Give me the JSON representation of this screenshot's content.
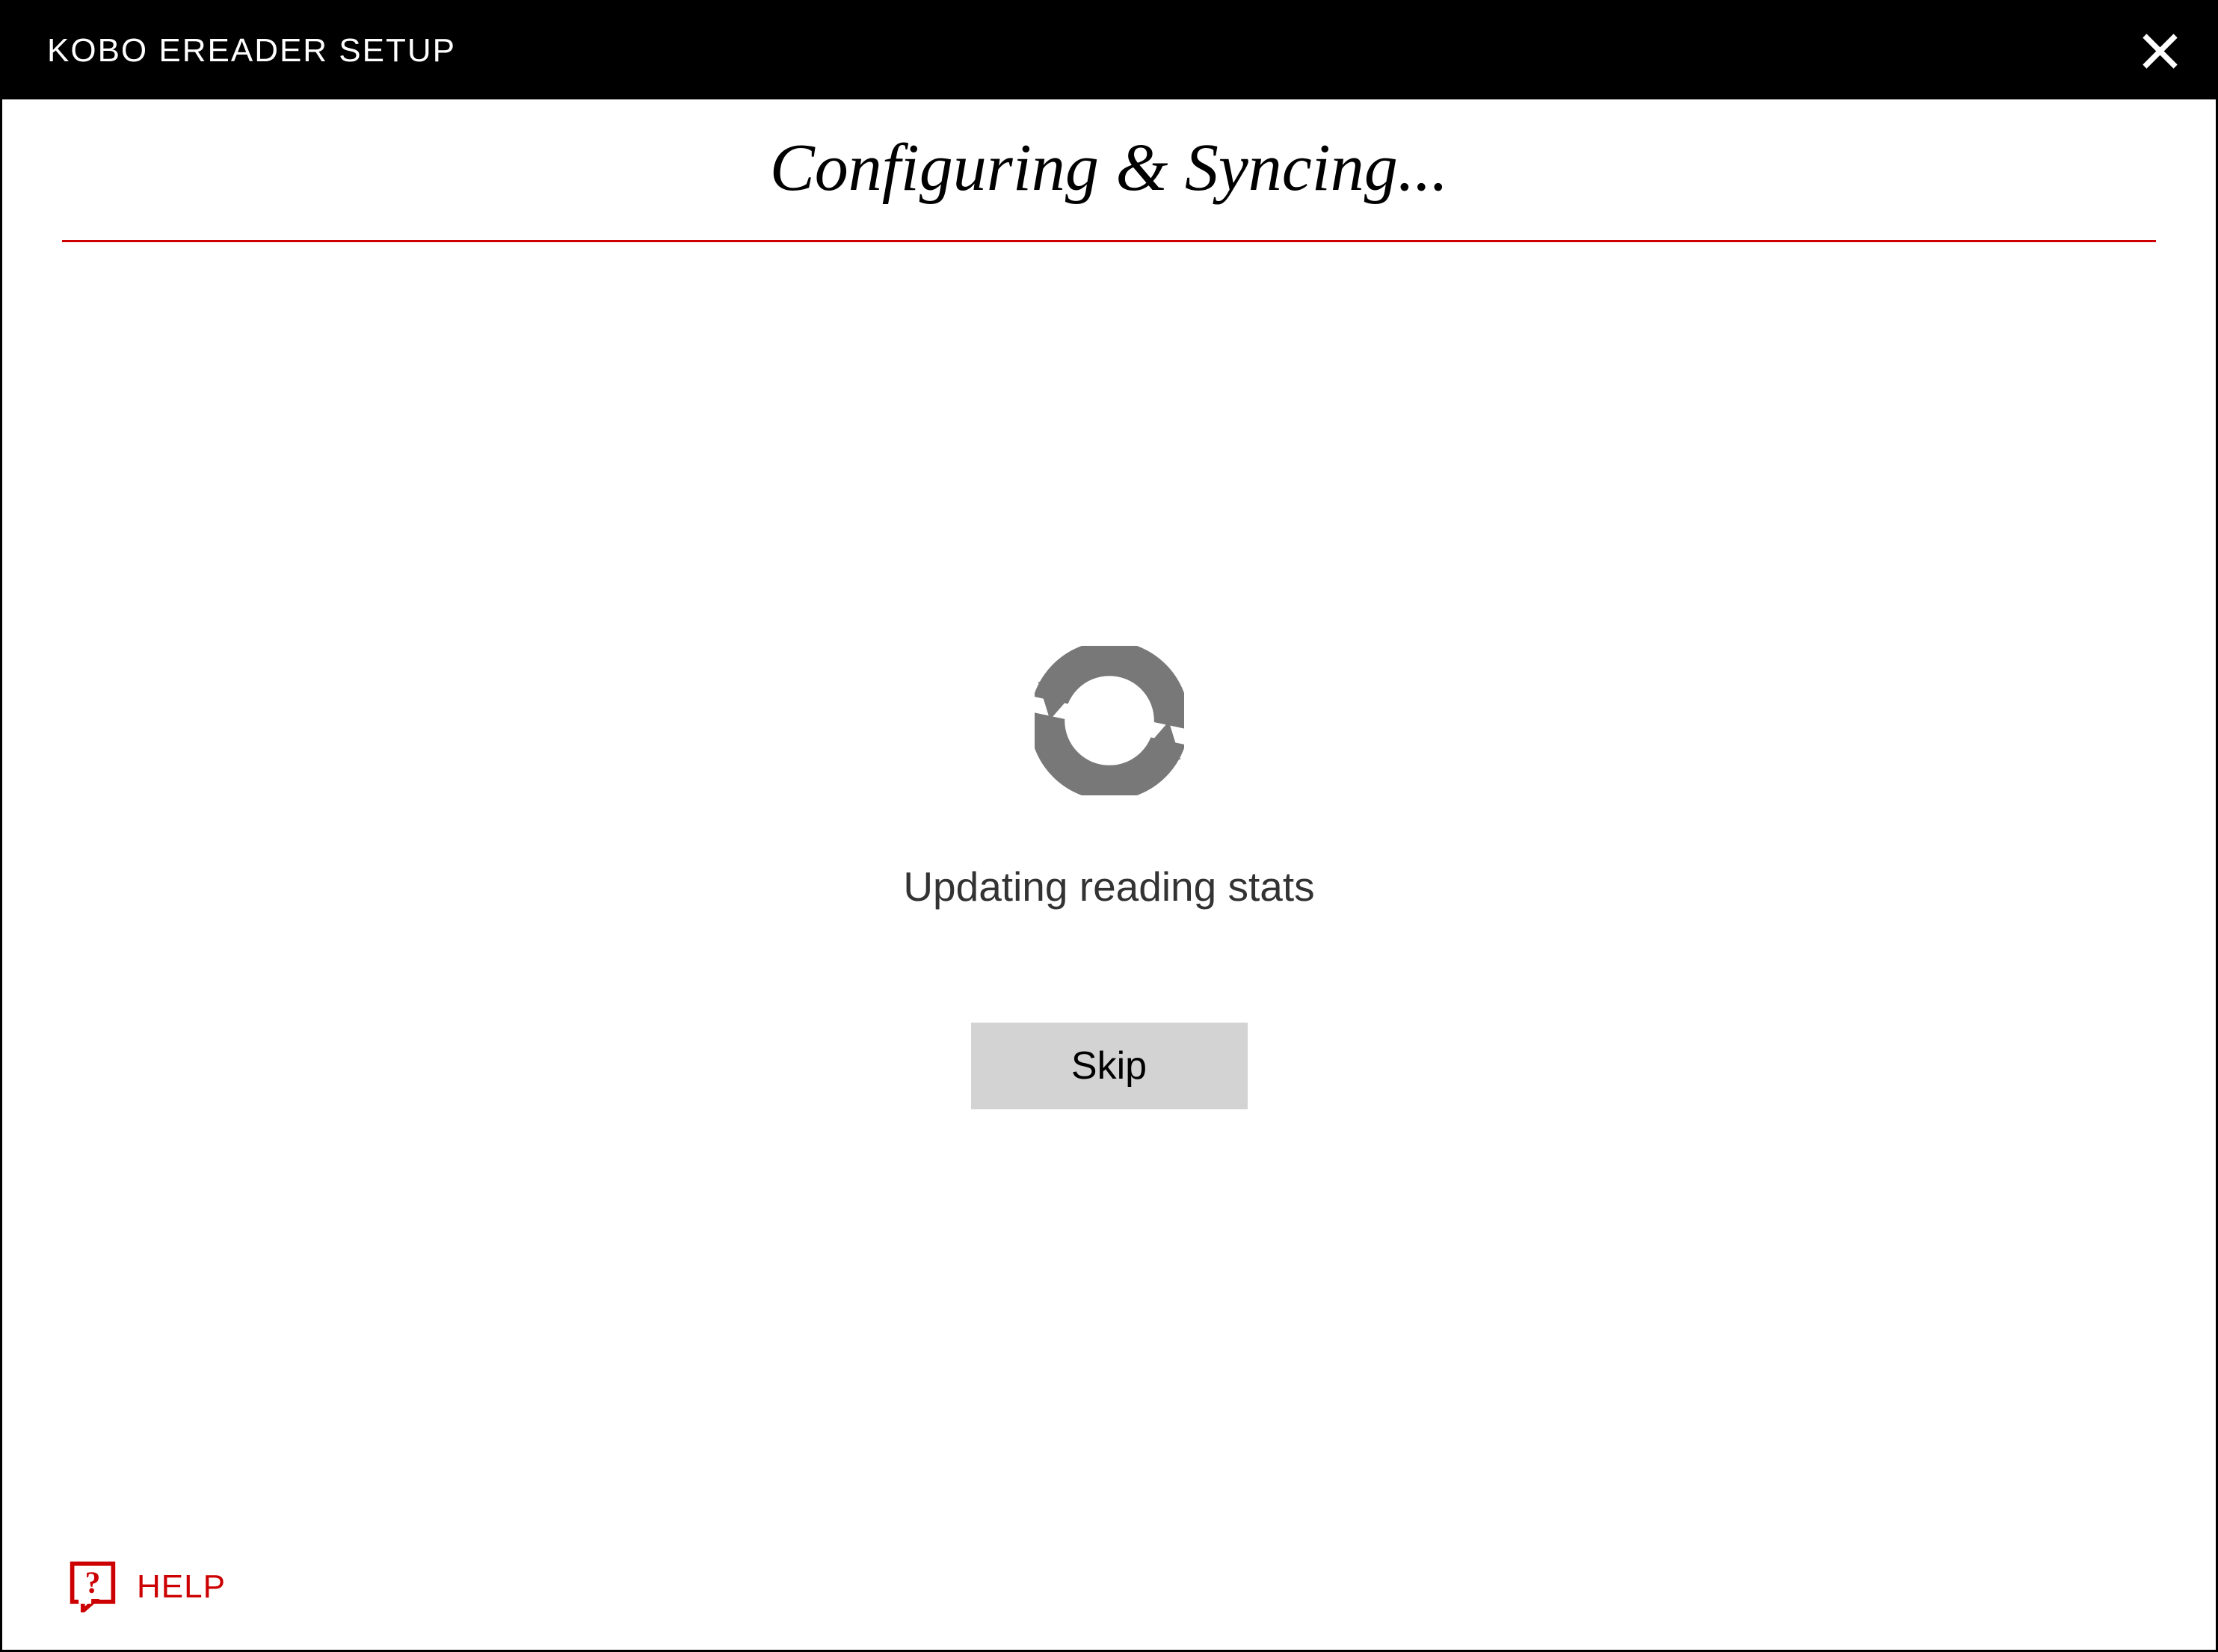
{
  "titlebar": {
    "title": "KOBO EREADER SETUP"
  },
  "heading": "Configuring & Syncing...",
  "status": "Updating reading stats",
  "skip_label": "Skip",
  "help_label": "HELP",
  "colors": {
    "accent": "#c00",
    "titlebar_bg": "#000",
    "button_bg": "#d3d3d3",
    "icon_gray": "#787878"
  }
}
